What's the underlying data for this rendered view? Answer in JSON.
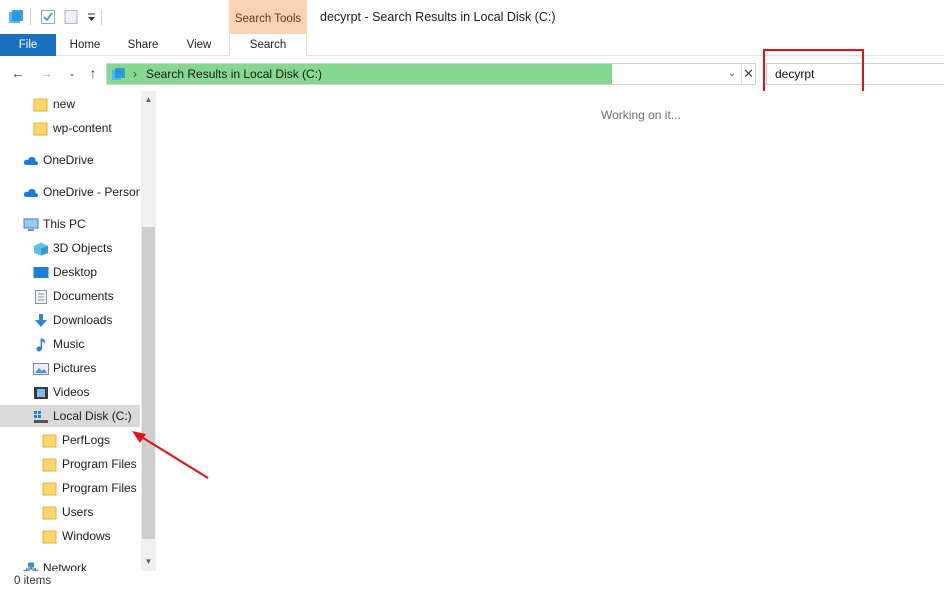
{
  "window": {
    "title": "decyrpt - Search Results in Local Disk (C:)",
    "context_group": "Search Tools"
  },
  "ribbon": {
    "tabs": [
      "File",
      "Home",
      "Share",
      "View",
      "Search"
    ]
  },
  "address_bar": {
    "path": "Search Results in Local Disk (C:)",
    "progress_fraction": 0.78
  },
  "search": {
    "value": "decyrpt"
  },
  "nav_pane": {
    "items": [
      {
        "label": "new",
        "icon": "folder-icon"
      },
      {
        "label": "wp-content",
        "icon": "folder-icon"
      },
      {
        "label": "OneDrive",
        "icon": "cloud-icon"
      },
      {
        "label": "OneDrive - Person",
        "icon": "cloud-icon"
      },
      {
        "label": "This PC",
        "icon": "computer-icon"
      },
      {
        "label": "3D Objects",
        "icon": "cube-icon"
      },
      {
        "label": "Desktop",
        "icon": "desktop-icon"
      },
      {
        "label": "Documents",
        "icon": "document-icon"
      },
      {
        "label": "Downloads",
        "icon": "download-icon"
      },
      {
        "label": "Music",
        "icon": "music-icon"
      },
      {
        "label": "Pictures",
        "icon": "picture-icon"
      },
      {
        "label": "Videos",
        "icon": "video-icon"
      },
      {
        "label": "Local Disk (C:)",
        "icon": "drive-icon",
        "selected": true
      },
      {
        "label": "PerfLogs",
        "icon": "folder-icon"
      },
      {
        "label": "Program Files",
        "icon": "folder-icon"
      },
      {
        "label": "Program Files (",
        "icon": "folder-icon"
      },
      {
        "label": "Users",
        "icon": "folder-icon"
      },
      {
        "label": "Windows",
        "icon": "folder-icon"
      },
      {
        "label": "Network",
        "icon": "network-icon"
      }
    ]
  },
  "content": {
    "status_message": "Working on it..."
  },
  "statusbar": {
    "item_count": "0 items"
  },
  "colors": {
    "file_tab": "#1a6fc0",
    "context_group": "#f9d3b6",
    "progress": "#86d78f",
    "annotation": "#e0131a",
    "selection": "#d9d9d9"
  }
}
